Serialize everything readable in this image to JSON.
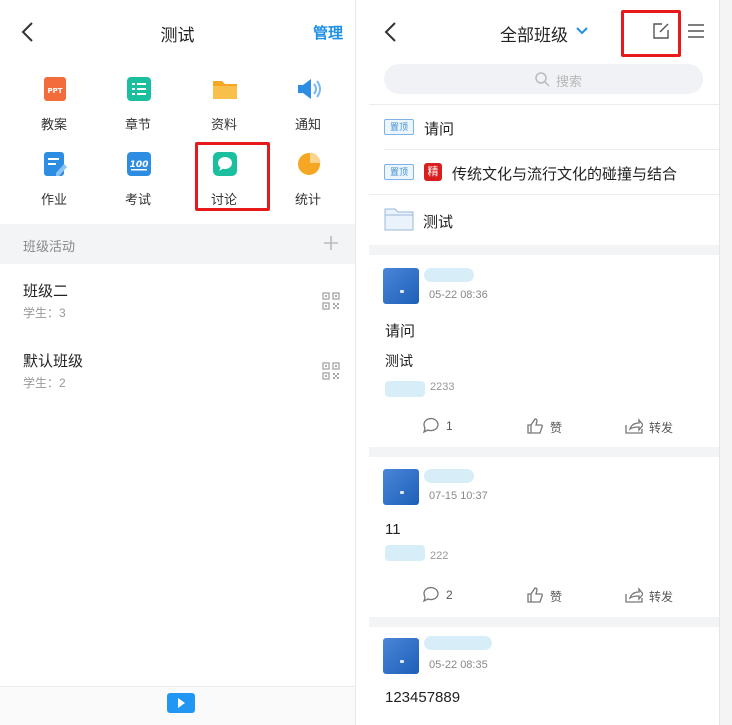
{
  "left": {
    "header": {
      "title": "测试",
      "manage": "管理"
    },
    "grid": [
      {
        "label": "教案",
        "icon": "ppt-icon",
        "color": "#f36c3c"
      },
      {
        "label": "章节",
        "icon": "chapter-list-icon",
        "color": "#1bbf9e"
      },
      {
        "label": "资料",
        "icon": "folder-icon",
        "color": "#f5a623"
      },
      {
        "label": "通知",
        "icon": "speaker-icon",
        "color": "#2d8de3"
      },
      {
        "label": "作业",
        "icon": "homework-pen-icon",
        "color": "#2d8de3"
      },
      {
        "label": "考试",
        "icon": "exam-100-icon",
        "color": "#2d8de3"
      },
      {
        "label": "讨论",
        "icon": "discussion-bubble-icon",
        "color": "#1bbf9e"
      },
      {
        "label": "统计",
        "icon": "pie-chart-icon",
        "color": "#f5a623"
      }
    ],
    "section_title": "班级活动",
    "classes": [
      {
        "name": "班级二",
        "students": "学生：3"
      },
      {
        "name": "默认班级",
        "students": "学生：2"
      }
    ]
  },
  "right": {
    "header": {
      "title": "全部班级"
    },
    "search": {
      "placeholder": "搜索"
    },
    "pinned": [
      {
        "tag": "置顶",
        "title": "请问"
      },
      {
        "tag": "置顶",
        "badge": "精",
        "title": "传统文化与流行文化的碰撞与结合"
      }
    ],
    "folder_name": "测试",
    "posts": [
      {
        "time": "05-22 08:36",
        "title": "请问",
        "body": "测试",
        "views": "2233",
        "comments": "1",
        "like": "赞",
        "share": "转发"
      },
      {
        "time": "07-15 10:37",
        "title": "",
        "body": "11",
        "views": "222",
        "comments": "2",
        "like": "赞",
        "share": "转发"
      },
      {
        "time": "05-22 08:35",
        "title": "",
        "body": "123457889"
      }
    ]
  },
  "colors": {
    "accent": "#1e90e6",
    "highlight_box": "#e8191b"
  }
}
